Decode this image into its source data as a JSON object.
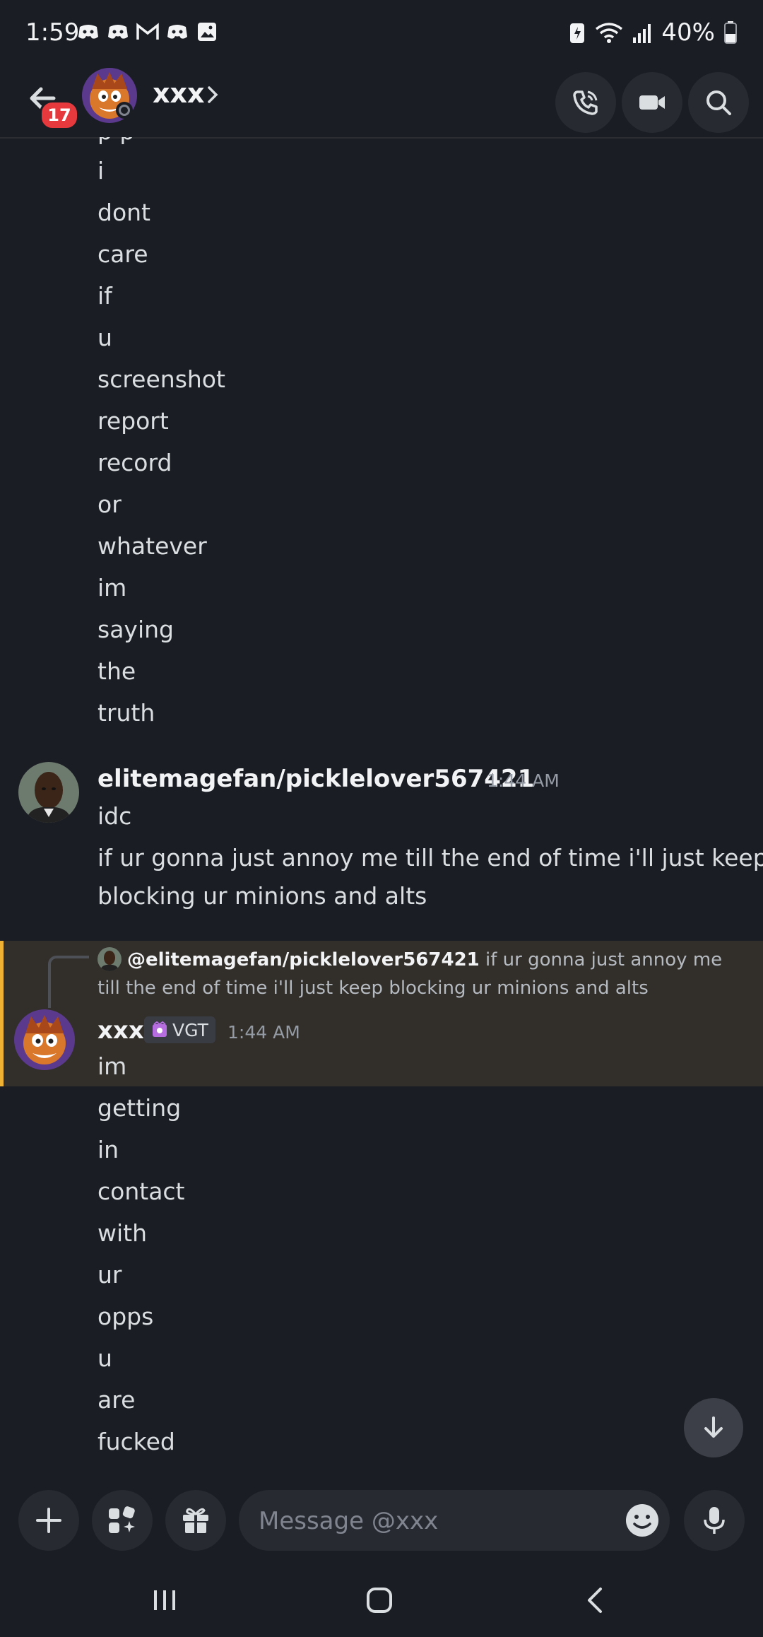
{
  "status_bar": {
    "time": "1:59",
    "battery": "40%"
  },
  "header": {
    "name": "xxx",
    "unread_badge": "17"
  },
  "top_partial_text": "p   p",
  "message_lines_top": [
    "i",
    "dont",
    "care",
    "if",
    "u",
    "screenshot",
    "report",
    "record",
    "or",
    "whatever",
    "im",
    "saying",
    "the",
    "truth"
  ],
  "message2": {
    "username": "elitemagefan/picklelover567421",
    "time": "1:44 AM",
    "lines": [
      "idc",
      "if ur gonna just annoy me till the end of time i'll just keep",
      "blocking ur minions and alts"
    ]
  },
  "message3": {
    "reply_mention": "@elitemagefan/picklelover567421",
    "reply_text": " if ur gonna just annoy me till the end of time i'll just keep blocking ur minions and alts",
    "username": "xxx",
    "tag": "VGT",
    "time": "1:44 AM",
    "lines": [
      "im",
      "getting",
      "in",
      "contact",
      "with",
      "ur",
      "opps",
      "u",
      "are",
      "fucked"
    ]
  },
  "composer": {
    "placeholder": "Message @xxx"
  },
  "colors": {
    "background": "#1b1d24",
    "highlight": "#322e29",
    "highlight_bar": "#f0b232",
    "badge": "#e5393d"
  },
  "icons": [
    "back-arrow-icon",
    "call-icon",
    "video-icon",
    "search-icon",
    "plus-icon",
    "apps-icon",
    "gift-icon",
    "emoji-icon",
    "microphone-icon",
    "arrow-down-icon"
  ]
}
